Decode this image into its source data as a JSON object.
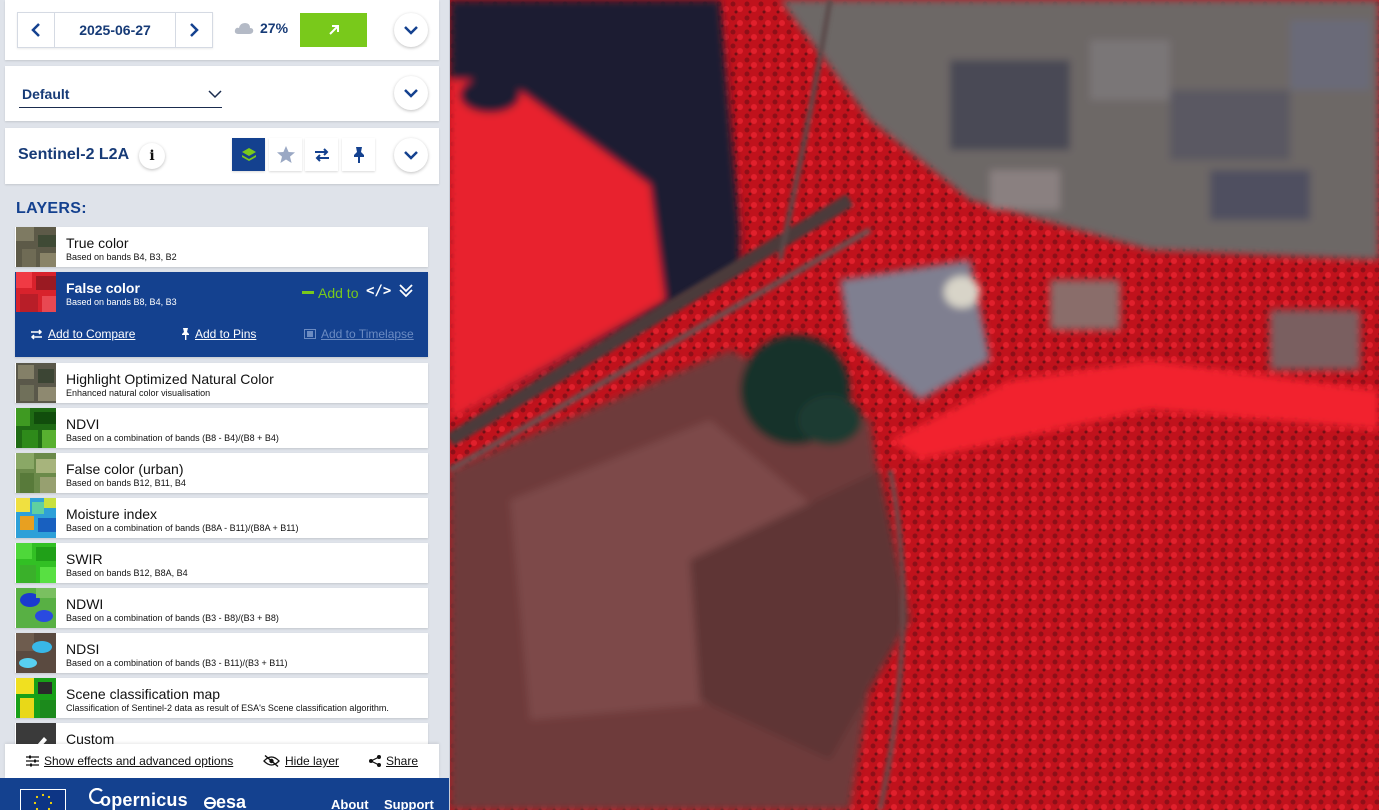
{
  "date_panel": {
    "date": "2025-06-27",
    "cloud_coverage": "27%"
  },
  "theme": {
    "selected": "Default"
  },
  "collection": {
    "title": "Sentinel-2 L2A",
    "info_glyph": "i"
  },
  "layers": {
    "heading": "LAYERS:",
    "items": [
      {
        "title": "True color",
        "description": "Based on bands B4, B3, B2",
        "thumb": "true-color"
      },
      {
        "title": "False color",
        "description": "Based on bands B8, B4, B3",
        "thumb": "false-color",
        "selected": true
      },
      {
        "title": "Highlight Optimized Natural Color",
        "description": "Enhanced natural color visualisation",
        "thumb": "true-color"
      },
      {
        "title": "NDVI",
        "description": "Based on a combination of bands (B8 - B4)/(B8 + B4)",
        "thumb": "ndvi"
      },
      {
        "title": "False color (urban)",
        "description": "Based on bands B12, B11, B4",
        "thumb": "urban"
      },
      {
        "title": "Moisture index",
        "description": "Based on a combination of bands (B8A - B11)/(B8A + B11)",
        "thumb": "moisture"
      },
      {
        "title": "SWIR",
        "description": "Based on bands B12, B8A, B4",
        "thumb": "swir"
      },
      {
        "title": "NDWI",
        "description": "Based on a combination of bands (B3 - B8)/(B3 + B8)",
        "thumb": "ndwi"
      },
      {
        "title": "NDSI",
        "description": "Based on a combination of bands (B3 - B11)/(B3 + B11)",
        "thumb": "ndsi"
      },
      {
        "title": "Scene classification map",
        "description": "Classification of Sentinel-2 data as result of ESA's Scene classification algorithm.",
        "thumb": "scl"
      },
      {
        "title": "Custom",
        "description": "",
        "thumb": "custom"
      }
    ],
    "selected_actions": {
      "add_to": "Add to",
      "add_to_compare": "Add to Compare",
      "add_to_pins": "Add to Pins",
      "add_to_timelapse": "Add to Timelapse"
    }
  },
  "bottom_bar": {
    "effects": "Show effects and advanced options",
    "hide_layer": "Hide layer",
    "share": "Share"
  },
  "footer": {
    "copernicus": "opernicus",
    "esa": "esa",
    "about": "About",
    "support": "Support"
  },
  "colors": {
    "brand_blue": "#14418f",
    "accent_green": "#79c91b"
  }
}
